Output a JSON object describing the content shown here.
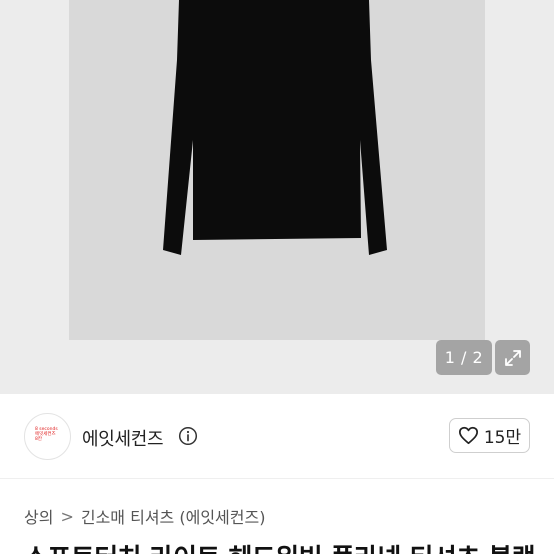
{
  "gallery": {
    "counter": "1 / 2"
  },
  "seller": {
    "avatar_text": "8 seconds\n에잇세컨즈\n8칸",
    "name": "에잇세컨즈",
    "likes": "15만"
  },
  "breadcrumb": {
    "items": [
      "상의",
      "긴소매 티셔츠 (에잇세컨즈)"
    ],
    "separator": ">"
  },
  "product": {
    "title": "소프트터치 라이트 헤드위빙 풀라넥 티셔츠 블랙"
  },
  "colors": {
    "gallery_bg": "#ececec",
    "photo_bg": "#d9d9d9",
    "shirt": "#0c0c0c",
    "brand_red": "#e02020"
  }
}
